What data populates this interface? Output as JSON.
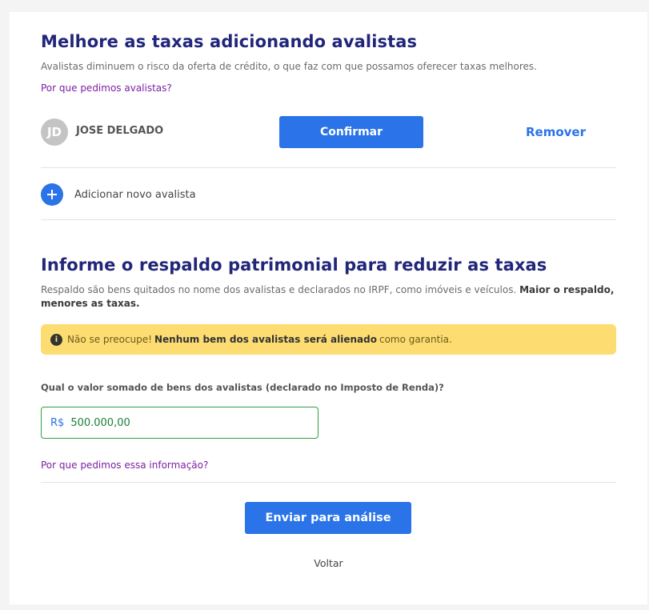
{
  "guarantors_section": {
    "title": "Melhore as taxas adicionando avalistas",
    "subtitle": "Avalistas diminuem o risco da oferta de crédito, o que faz com que possamos oferecer taxas melhores.",
    "why_link": "Por que pedimos avalistas?",
    "guarantor": {
      "initials": "JD",
      "name": "JOSE DELGADO",
      "confirm_label": "Confirmar",
      "remove_label": "Remover"
    },
    "add_label": "Adicionar novo avalista"
  },
  "assets_section": {
    "title": "Informe o respaldo patrimonial para reduzir as taxas",
    "subtitle_plain": "Respaldo são bens quitados no nome dos avalistas e declarados no IRPF, como imóveis e veículos.",
    "subtitle_bold": "Maior o respaldo, menores as taxas.",
    "alert": {
      "icon": "info-icon",
      "prefix": "Não se preocupe!",
      "bold": "Nenhum bem dos avalistas será alienado",
      "suffix": "como garantia."
    },
    "question": "Qual o valor somado de bens dos avalistas (declarado no Imposto de Renda)?",
    "currency": "R$",
    "amount_value": "500.000,00",
    "why_link": "Por que pedimos essa informação?"
  },
  "footer": {
    "submit_label": "Enviar para análise",
    "back_label": "Voltar"
  },
  "colors": {
    "title": "#22267a",
    "primary": "#2a73e8",
    "link": "#7b1fa2",
    "alert_bg": "#fddd72",
    "input_border": "#2ea043"
  }
}
